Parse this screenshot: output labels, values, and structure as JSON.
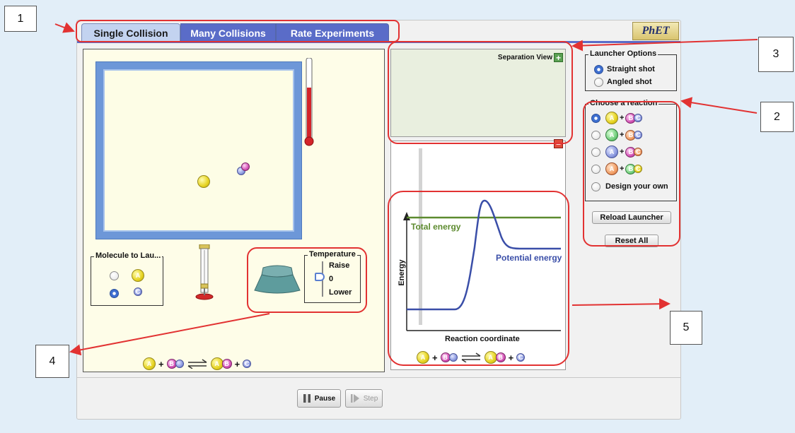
{
  "tabs": [
    {
      "label": "Single Collision",
      "active": true
    },
    {
      "label": "Many Collisions",
      "active": false
    },
    {
      "label": "Rate Experiments",
      "active": false
    }
  ],
  "logo": "PhET",
  "reaction_box": {
    "molecule_to_launch": {
      "title": "Molecule to Lau...",
      "options": [
        {
          "label": "A",
          "selected": false
        },
        {
          "label": "C",
          "selected": true
        }
      ]
    },
    "temperature": {
      "title": "Temperature",
      "raise_label": "Raise",
      "zero_label": "0",
      "lower_label": "Lower"
    }
  },
  "separation_view": {
    "label": "Separation View",
    "plus_icon": "+",
    "minus_icon": "−"
  },
  "energy_graph": {
    "total_energy_label": "Total energy",
    "potential_energy_label": "Potential energy",
    "y_axis_label": "Energy",
    "x_axis_label": "Reaction coordinate",
    "colors": {
      "total": "#5c8a2e",
      "potential": "#3a4ea8"
    }
  },
  "equation": {
    "plus": "+",
    "A": "A",
    "B": "B",
    "C": "C",
    "AB_A": "A",
    "AB_B": "B"
  },
  "launcher_options": {
    "title": "Launcher Options",
    "options": [
      {
        "label": "Straight shot",
        "selected": true
      },
      {
        "label": "Angled shot",
        "selected": false
      }
    ]
  },
  "choose_reaction": {
    "title": "Choose a reaction",
    "reactions": [
      {
        "a": "A",
        "b": "B",
        "c": "C",
        "selected": true,
        "a_color": "yellow",
        "bc_color": "pink"
      },
      {
        "a": "A",
        "b": "B",
        "c": "C",
        "selected": false,
        "a_color": "green",
        "bc_color": "orange"
      },
      {
        "a": "A",
        "b": "B",
        "c": "C",
        "selected": false,
        "a_color": "blue",
        "bc_color": "pink"
      },
      {
        "a": "A",
        "b": "B",
        "c": "C",
        "selected": false,
        "a_color": "orange",
        "bc_color": "green"
      }
    ],
    "plus": "+",
    "design_own_label": "Design your own"
  },
  "buttons": {
    "reload": "Reload Launcher",
    "reset": "Reset All",
    "pause": "Pause",
    "step": "Step"
  },
  "callouts": [
    "1",
    "2",
    "3",
    "4",
    "5"
  ],
  "annotation_color": "#e23232"
}
